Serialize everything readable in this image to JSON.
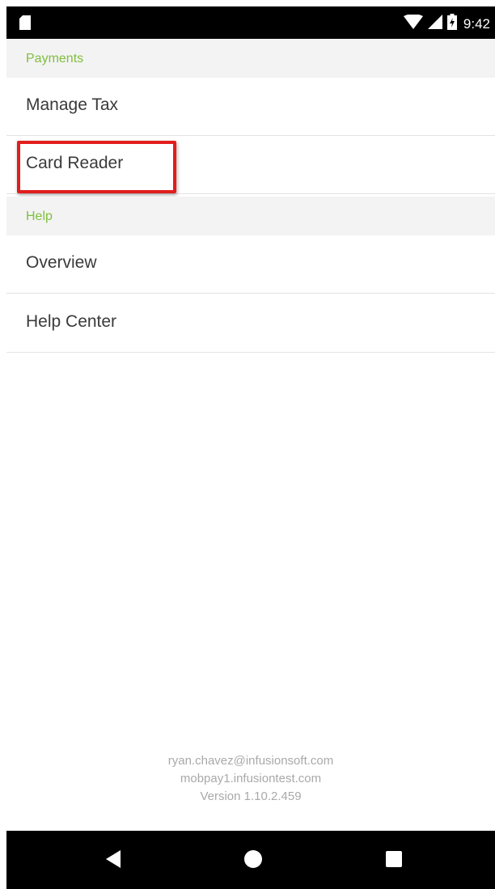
{
  "status_bar": {
    "time": "9:42",
    "icons": [
      "sd-card-icon",
      "wifi-icon",
      "signal-icon",
      "battery-icon"
    ]
  },
  "sections": [
    {
      "header": "Payments",
      "items": [
        "Manage Tax",
        "Card Reader"
      ]
    },
    {
      "header": "Help",
      "items": [
        "Overview",
        "Help Center"
      ]
    }
  ],
  "highlighted_item": "Card Reader",
  "footer": {
    "email": "ryan.chavez@infusionsoft.com",
    "domain": "mobpay1.infusiontest.com",
    "version": "Version 1.10.2.459"
  },
  "nav_bar": {
    "buttons": [
      "back-icon",
      "home-icon",
      "recents-icon"
    ]
  },
  "colors": {
    "section_header_text": "#7fbf3e",
    "highlight_border": "#e21d1d",
    "bars": "#000000"
  }
}
